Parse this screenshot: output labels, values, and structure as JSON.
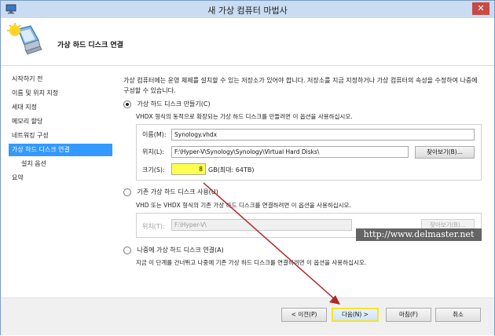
{
  "window": {
    "title": "새 가상 컴퓨터 마법사",
    "close_label": "✕"
  },
  "banner": {
    "heading": "가상 하드 디스크 연결"
  },
  "nav": {
    "items": [
      {
        "label": "시작하기 전"
      },
      {
        "label": "이름 및 위치 지정"
      },
      {
        "label": "세대 지정"
      },
      {
        "label": "메모리 할당"
      },
      {
        "label": "네트워킹 구성"
      },
      {
        "label": "가상 하드 디스크 연결",
        "active": true
      },
      {
        "label": "설치 옵션",
        "sub": true
      },
      {
        "label": "요약"
      }
    ]
  },
  "intro": "가상 컴퓨터에는 운영 체제를 설치할 수 있는 저장소가 있어야 합니다. 저장소를 지금 지정하거나 가상 컴퓨터의 속성을 수정하여 나중에 구성할 수 있습니다.",
  "option_create": {
    "label": "가상 하드 디스크 만들기(C)",
    "selected": true,
    "description": "VHDX 형식의 동적으로 확장되는 가상 하드 디스크를 만들려면 이 옵션을 사용하십시오.",
    "name_label": "이름(M):",
    "name_value": "Synology.vhdx",
    "location_label": "위치(L):",
    "location_value": "F:\\Hyper-V\\Synology\\Synology\\Virtual Hard Disks\\",
    "browse_label": "찾아보기(B)...",
    "size_label": "크기(S):",
    "size_value": "8",
    "size_unit": "GB(최대: 64TB)"
  },
  "option_existing": {
    "label": "기존 가상 하드 디스크 사용(U)",
    "selected": false,
    "description": "VHD 또는 VHDX 형식의 기존 가상 하드 디스크를 연결하려면 이 옵션을 사용하십시오.",
    "location_label": "위치(T):",
    "location_value": "F:\\Hyper-V\\",
    "browse_label": "찾아보기(B)..."
  },
  "option_later": {
    "label": "나중에 가상 하드 디스크 연결(A)",
    "selected": false,
    "description": "지금 이 단계를 건너뛰고 나중에 기존 가상 하드 디스크를 연결하려면 이 옵션을 사용하십시오."
  },
  "footer": {
    "prev_label": "< 이전(P)",
    "next_label": "다음(N) >",
    "finish_label": "마침(F)",
    "cancel_label": "취소"
  },
  "watermark": "http://www.delmaster.net",
  "colors": {
    "accent": "#3399ff",
    "highlight": "#ffff4d",
    "annotation_arrow": "#b0282a"
  }
}
